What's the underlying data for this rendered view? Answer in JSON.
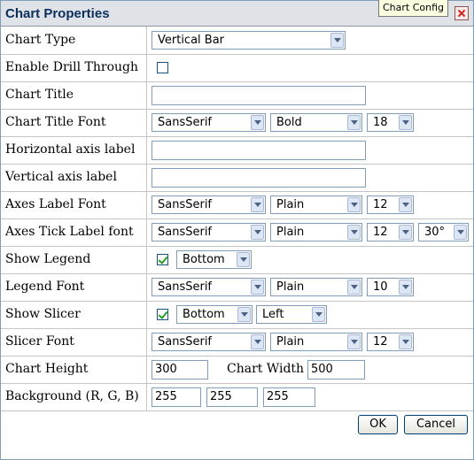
{
  "dialog": {
    "title": "Chart Properties",
    "tooltip": "Chart Config",
    "close_icon": "close-icon"
  },
  "rows": {
    "chart_type": {
      "label": "Chart Type",
      "value": "Vertical Bar"
    },
    "drill_through": {
      "label": "Enable Drill Through",
      "checked": false
    },
    "chart_title": {
      "label": "Chart Title",
      "value": ""
    },
    "chart_title_font": {
      "label": "Chart Title Font",
      "family": "SansSerif",
      "style": "Bold",
      "size": "18"
    },
    "h_axis_label": {
      "label": "Horizontal axis label",
      "value": ""
    },
    "v_axis_label": {
      "label": "Vertical axis label",
      "value": ""
    },
    "axes_label_font": {
      "label": "Axes Label Font",
      "family": "SansSerif",
      "style": "Plain",
      "size": "12"
    },
    "axes_tick_font": {
      "label": "Axes Tick Label font",
      "family": "SansSerif",
      "style": "Plain",
      "size": "12",
      "angle": "30°"
    },
    "show_legend": {
      "label": "Show Legend",
      "checked": true,
      "position": "Bottom"
    },
    "legend_font": {
      "label": "Legend Font",
      "family": "SansSerif",
      "style": "Plain",
      "size": "10"
    },
    "show_slicer": {
      "label": "Show Slicer",
      "checked": true,
      "position": "Bottom",
      "align": "Left"
    },
    "slicer_font": {
      "label": "Slicer Font",
      "family": "SansSerif",
      "style": "Plain",
      "size": "12"
    },
    "chart_size": {
      "height_label": "Chart Height",
      "height": "300",
      "width_label": "Chart Width",
      "width": "500"
    },
    "background": {
      "label": "Background (R, G, B)",
      "r": "255",
      "g": "255",
      "b": "255"
    }
  },
  "buttons": {
    "ok": "OK",
    "cancel": "Cancel"
  },
  "colors": {
    "titlebar": "#dfe3e8",
    "check": "#21a121",
    "close": "#d12424"
  }
}
